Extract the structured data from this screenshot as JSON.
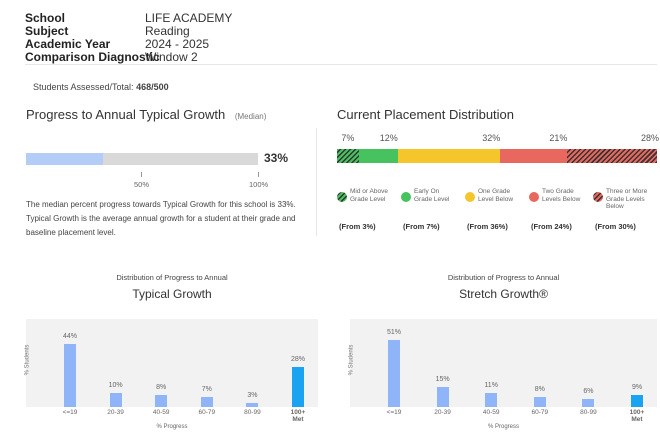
{
  "header": {
    "school_label": "School",
    "school_value": "LIFE ACADEMY",
    "subject_label": "Subject",
    "subject_value": "Reading",
    "year_label": "Academic Year",
    "year_value": "2024 - 2025",
    "diag_label": "Comparison Diagnostic",
    "diag_value": "Window 2"
  },
  "assessed": {
    "label": "Students Assessed/Total: ",
    "value": "468/500"
  },
  "progress": {
    "title": "Progress to Annual Typical Growth",
    "subtitle": "(Median)",
    "percent": "33%",
    "fill_fraction": 0.33,
    "tick1": "50%",
    "tick2": "100%",
    "desc": "The median percent progress towards Typical Growth for this school is 33%. Typical Growth is the average annual growth for a student at their grade and baseline placement level."
  },
  "placement": {
    "title": "Current Placement Distribution",
    "segments": [
      {
        "label": "7%",
        "value": 7,
        "color": "#46c25e",
        "hatch": true
      },
      {
        "label": "12%",
        "value": 12,
        "color": "#46c25e",
        "hatch": false
      },
      {
        "label": "32%",
        "value": 32,
        "color": "#f5c62b",
        "hatch": false
      },
      {
        "label": "21%",
        "value": 21,
        "color": "#e8685f",
        "hatch": false
      },
      {
        "label": "28%",
        "value": 28,
        "color": "#e8685f",
        "hatch": true
      }
    ],
    "legend": [
      {
        "l1": "Mid or Above",
        "l2": "Grade Level",
        "l3": "",
        "color": "#46c25e",
        "hatch": true,
        "from": "(From 3%)"
      },
      {
        "l1": "Early On",
        "l2": "Grade Level",
        "l3": "",
        "color": "#46c25e",
        "hatch": false,
        "from": "(From 7%)"
      },
      {
        "l1": "One Grade",
        "l2": "Level Below",
        "l3": "",
        "color": "#f5c62b",
        "hatch": false,
        "from": "(From 36%)"
      },
      {
        "l1": "Two Grade",
        "l2": "Levels Below",
        "l3": "",
        "color": "#e8685f",
        "hatch": false,
        "from": "(From 24%)"
      },
      {
        "l1": "Three or More",
        "l2": "Grade Levels",
        "l3": "Below",
        "color": "#e8685f",
        "hatch": true,
        "from": "(From 30%)"
      }
    ]
  },
  "chart_data": [
    {
      "type": "bar",
      "subtitle": "Distribution of Progress to Annual",
      "title": "Typical Growth",
      "ylabel": "% Students",
      "xlabel": "% Progress",
      "categories": [
        "<=19",
        "20-39",
        "40-59",
        "60-79",
        "80-99",
        "100+ Met"
      ],
      "values": [
        44,
        10,
        8,
        7,
        3,
        28
      ],
      "value_labels": [
        "44%",
        "10%",
        "8%",
        "7%",
        "3%",
        "28%"
      ],
      "ylim": [
        0,
        50
      ]
    },
    {
      "type": "bar",
      "subtitle": "Distribution of Progress to Annual",
      "title": "Stretch Growth®",
      "ylabel": "% Students",
      "xlabel": "% Progress",
      "categories": [
        "<=19",
        "20-39",
        "40-59",
        "60-79",
        "80-99",
        "100+ Met"
      ],
      "values": [
        51,
        15,
        11,
        8,
        6,
        9
      ],
      "value_labels": [
        "51%",
        "15%",
        "11%",
        "8%",
        "6%",
        "9%"
      ],
      "ylim": [
        0,
        55
      ]
    }
  ],
  "colors": {
    "bar_light": "#8fb4f7",
    "bar_met": "#1aa3f0",
    "progress_fill": "#b3cdf7",
    "progress_track": "#d9d9d9"
  }
}
